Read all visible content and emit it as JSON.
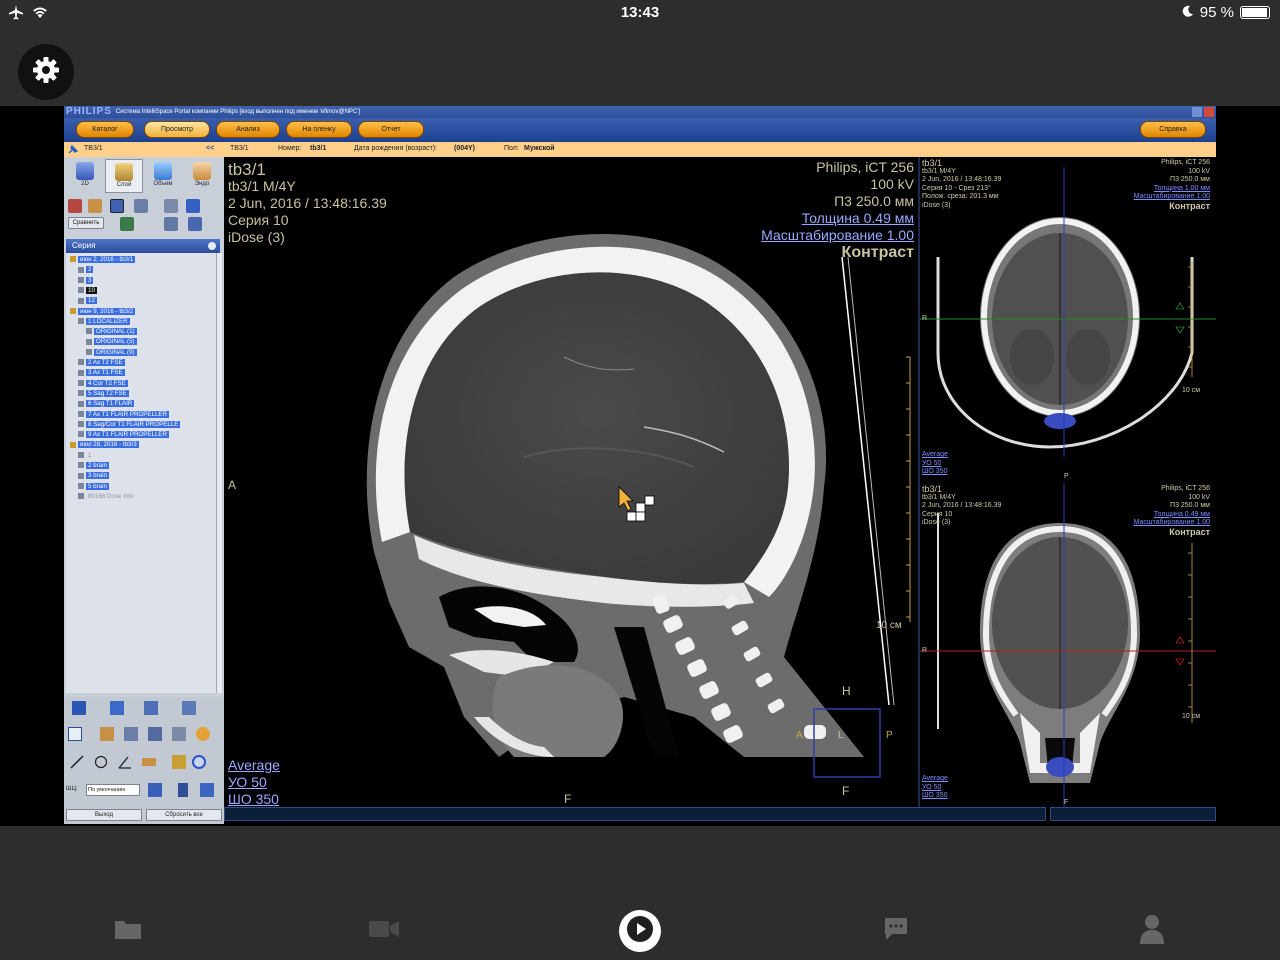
{
  "status": {
    "time": "13:43",
    "battery": "95 %",
    "battery_level": 0.95
  },
  "app": {
    "settings_icon": "gear-icon"
  },
  "window": {
    "brand": "PHILIPS",
    "title": "Система IntelliSpace Portal компании Philips [вход выполнен под именем 'efimov@NPC']"
  },
  "toolbar": {
    "catalog": "Каталог",
    "view": "Просмотр",
    "analysis": "Анализ",
    "film": "На пленку",
    "report": "Отчет",
    "help": "Справка"
  },
  "info": {
    "patient": "TB3/1",
    "collapse": "<<",
    "id_label": "Номер:",
    "id_value": "tb3/1",
    "dob_label": "Дата рождения (возраст):",
    "dob_value": "(004Y)",
    "sex_label": "Пол:",
    "sex_value": "Мужской"
  },
  "left_panel": {
    "tabs": [
      "2D",
      "Слой",
      "Объем",
      "Эндо"
    ],
    "compare": "Сравнить",
    "series_header": "Серия",
    "tree": [
      {
        "text": "июн 2, 2016 - tb3/1",
        "indent": 0,
        "style": "sel"
      },
      {
        "text": "2",
        "indent": 1,
        "style": "sel"
      },
      {
        "text": "3",
        "indent": 1,
        "style": "sel"
      },
      {
        "text": "10",
        "indent": 1,
        "style": "black"
      },
      {
        "text": "12",
        "indent": 1,
        "style": "sel"
      },
      {
        "text": "июн 9, 2016 - tb3/2",
        "indent": 0,
        "style": "sel"
      },
      {
        "text": "1 LOCALIZER",
        "indent": 1,
        "style": "sel"
      },
      {
        "text": "ORIGINAL (1)",
        "indent": 2,
        "style": "sel"
      },
      {
        "text": "ORIGINAL (5)",
        "indent": 2,
        "style": "sel"
      },
      {
        "text": "ORIGINAL (9)",
        "indent": 2,
        "style": "sel"
      },
      {
        "text": "2 Ax T2 FSE",
        "indent": 1,
        "style": "sel"
      },
      {
        "text": "3 Ax T1 FSE",
        "indent": 1,
        "style": "sel"
      },
      {
        "text": "4 Cor T2 FSE",
        "indent": 1,
        "style": "sel"
      },
      {
        "text": "5 Sag T2 FSE",
        "indent": 1,
        "style": "sel"
      },
      {
        "text": "6 Sag T1 FLAIR",
        "indent": 1,
        "style": "sel"
      },
      {
        "text": "7 Ax T1 FLAIR PROPELLER",
        "indent": 1,
        "style": "sel"
      },
      {
        "text": "8 Sag/Cor T1 FLAIR PROPELLE",
        "indent": 1,
        "style": "sel"
      },
      {
        "text": "9 Ax T1 FLAIR PROPELLER",
        "indent": 1,
        "style": "sel"
      },
      {
        "text": "июл 28, 2016 - tb3/3",
        "indent": 0,
        "style": "sel"
      },
      {
        "text": "1",
        "indent": 1,
        "style": "plain"
      },
      {
        "text": "2 brain",
        "indent": 1,
        "style": "sel"
      },
      {
        "text": "3 brain",
        "indent": 1,
        "style": "sel"
      },
      {
        "text": "5 brain",
        "indent": 1,
        "style": "sel"
      },
      {
        "text": "80168 Dose Info",
        "indent": 1,
        "style": "plain"
      }
    ],
    "wl_label": "ШЦ:",
    "wl_value": "По умолчанию",
    "exit": "Выход",
    "reset": "Сбросить все"
  },
  "main_view": {
    "tl": [
      "tb3/1",
      "tb3/1 M/4Y",
      "2 Jun, 2016 / 13:48:16.39",
      "Серия 10",
      "iDose (3)"
    ],
    "tr_plain": [
      "Philips, iCT 256",
      "100 kV",
      "П3 250.0 мм"
    ],
    "tr_links": [
      "Толщина 0.49 мм",
      "Масштабирование 1.00"
    ],
    "tr_bold": "Контраст",
    "bl_link": "Average",
    "bl": [
      "УО    50",
      "ШО   350"
    ],
    "orient_left": "A",
    "orient_bottom": "F",
    "orient_right_top": "H",
    "orient_right_bottom": "F",
    "orient_box_left": "A",
    "orient_box_mid": "L",
    "orient_box_right": "P",
    "scale_label": "10 см"
  },
  "axial_view": {
    "tl": [
      "tb3/1",
      "tb3/1 M/4Y",
      "2 Jun, 2016 / 13:48:16.39",
      "Серия 10 - Срез 213°",
      "Полож. среза: 201.3 мм",
      "iDose (3)"
    ],
    "tr_plain": [
      "Philips, iCT 256",
      "100 kV",
      "П3 250.0 мм"
    ],
    "tr_links": [
      "Толщина 1.00 мм",
      "Масштабирование 1.00"
    ],
    "tr_bold": "Контраст",
    "bl_link": "Average",
    "bl_links": [
      "УО     50",
      "ШО    350"
    ],
    "orient_r": "R",
    "orient_p": "P",
    "scale": "10 см"
  },
  "coronal_view": {
    "tl": [
      "tb3/1",
      "tb3/1 M/4Y",
      "2 Jun, 2016 / 13:48:16.39",
      "Серия 10",
      "iDose (3)"
    ],
    "tr_plain": [
      "Philips, iCT 256",
      "100 kV",
      "П3 250.0 мм"
    ],
    "tr_links": [
      "Толщина 0.49 мм",
      "Масштабирование 1.00"
    ],
    "tr_bold": "Контраст",
    "bl_link": "Average",
    "bl_links": [
      "УО     50",
      "ШО    350"
    ],
    "orient_r": "R",
    "orient_f": "F",
    "scale": "10 см"
  },
  "bottom_nav": [
    "folder-icon",
    "video-icon",
    "play-icon",
    "chat-icon",
    "user-icon"
  ]
}
